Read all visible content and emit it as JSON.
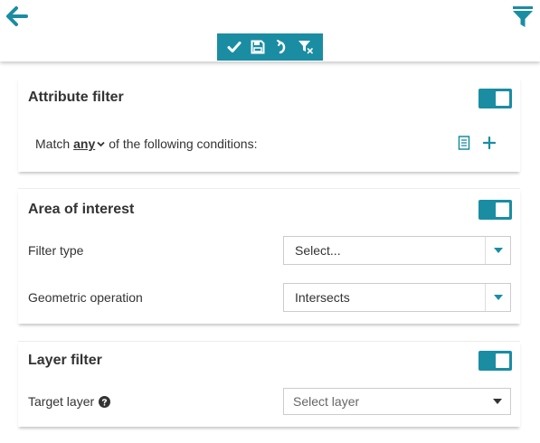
{
  "colors": {
    "accent": "#1a8da3",
    "text": "#333333",
    "border": "#cccccc"
  },
  "header": {
    "back_icon": "arrow-left-icon",
    "filter_icon": "funnel-icon",
    "toolbar": [
      {
        "name": "apply",
        "icon": "check-icon"
      },
      {
        "name": "save",
        "icon": "floppy-disk-icon"
      },
      {
        "name": "undo",
        "icon": "undo-icon"
      },
      {
        "name": "clear-filter",
        "icon": "filter-clear-icon"
      }
    ]
  },
  "attribute_filter": {
    "title": "Attribute filter",
    "enabled": true,
    "match_prefix": "Match",
    "match_value": "any",
    "match_suffix": "of the following conditions:"
  },
  "area_of_interest": {
    "title": "Area of interest",
    "enabled": true,
    "filter_type_label": "Filter type",
    "filter_type_value": "Select...",
    "geometric_operation_label": "Geometric operation",
    "geometric_operation_value": "Intersects"
  },
  "layer_filter": {
    "title": "Layer filter",
    "enabled": true,
    "target_layer_label": "Target layer",
    "target_layer_placeholder": "Select layer"
  }
}
